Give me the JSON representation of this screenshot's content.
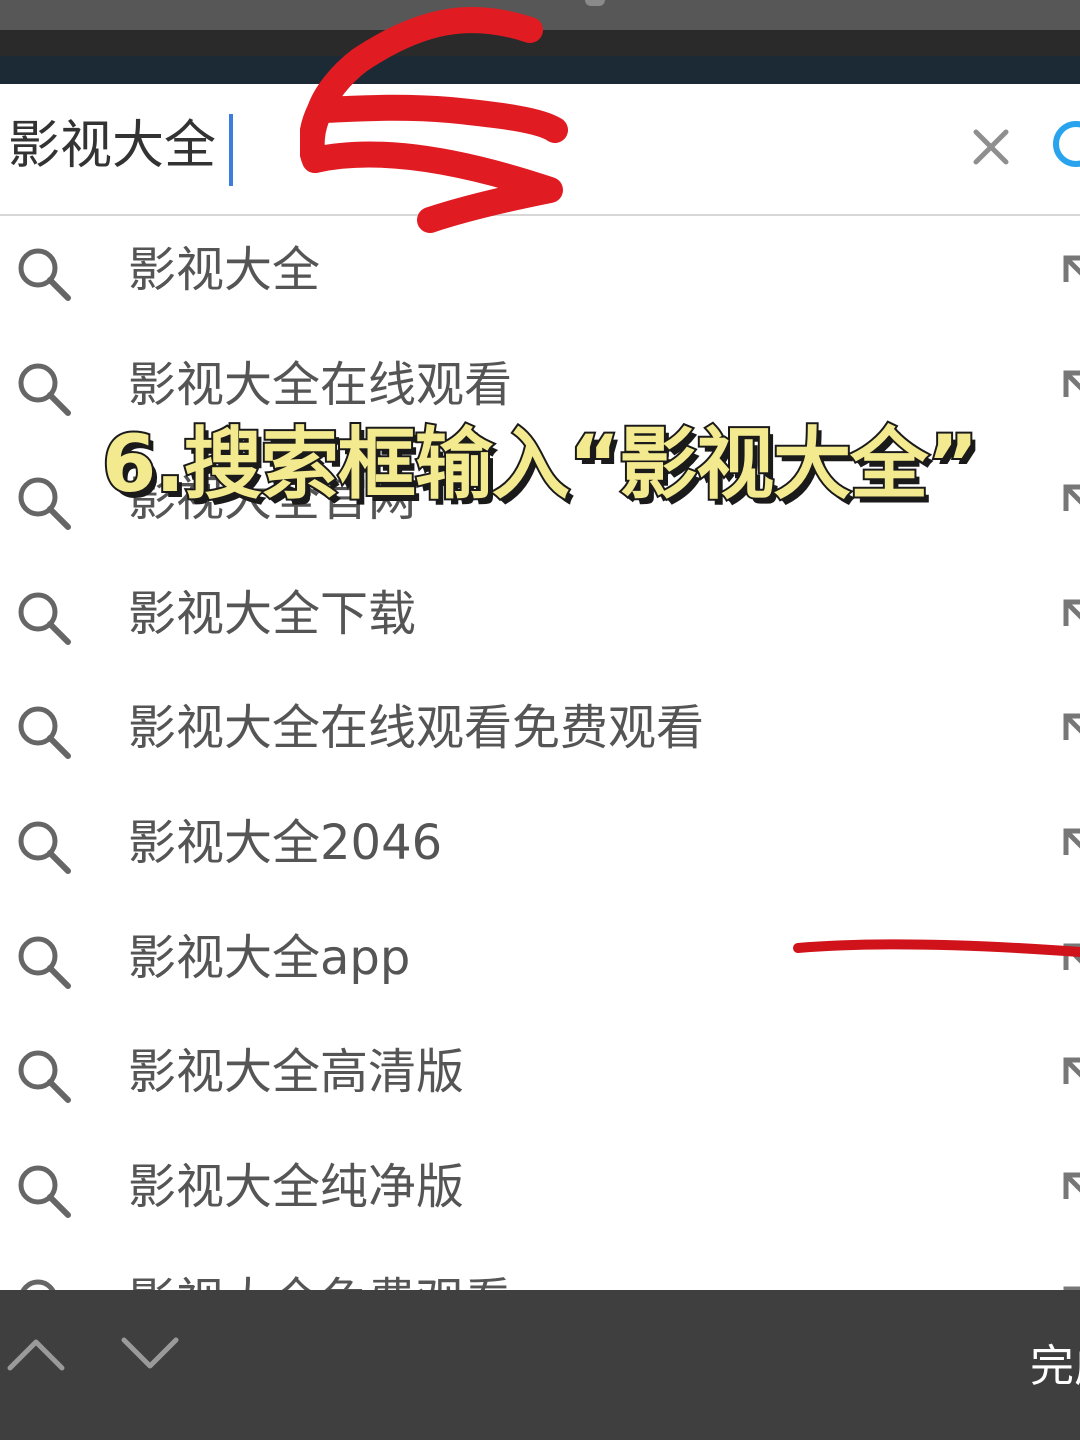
{
  "search": {
    "value": "影视大全",
    "clear_icon": "close-icon",
    "go_icon": "search-icon"
  },
  "suggestions": [
    {
      "text": "影视大全"
    },
    {
      "text": "影视大全在线观看"
    },
    {
      "text": "影视大全官网"
    },
    {
      "text": "影视大全下载"
    },
    {
      "text": "影视大全在线观看免费观看"
    },
    {
      "text": "影视大全2046"
    },
    {
      "text": "影视大全app"
    },
    {
      "text": "影视大全高清版"
    },
    {
      "text": "影视大全纯净版"
    },
    {
      "text": "影视大全免费观看"
    }
  ],
  "overlay": {
    "title": "6.搜索框输入“影视大全”",
    "title_color": "#f3e98f",
    "annotation_color": "#e11b22"
  },
  "toolbar": {
    "prev_icon": "chevron-up-icon",
    "next_icon": "chevron-down-icon",
    "done_label": "完成"
  }
}
